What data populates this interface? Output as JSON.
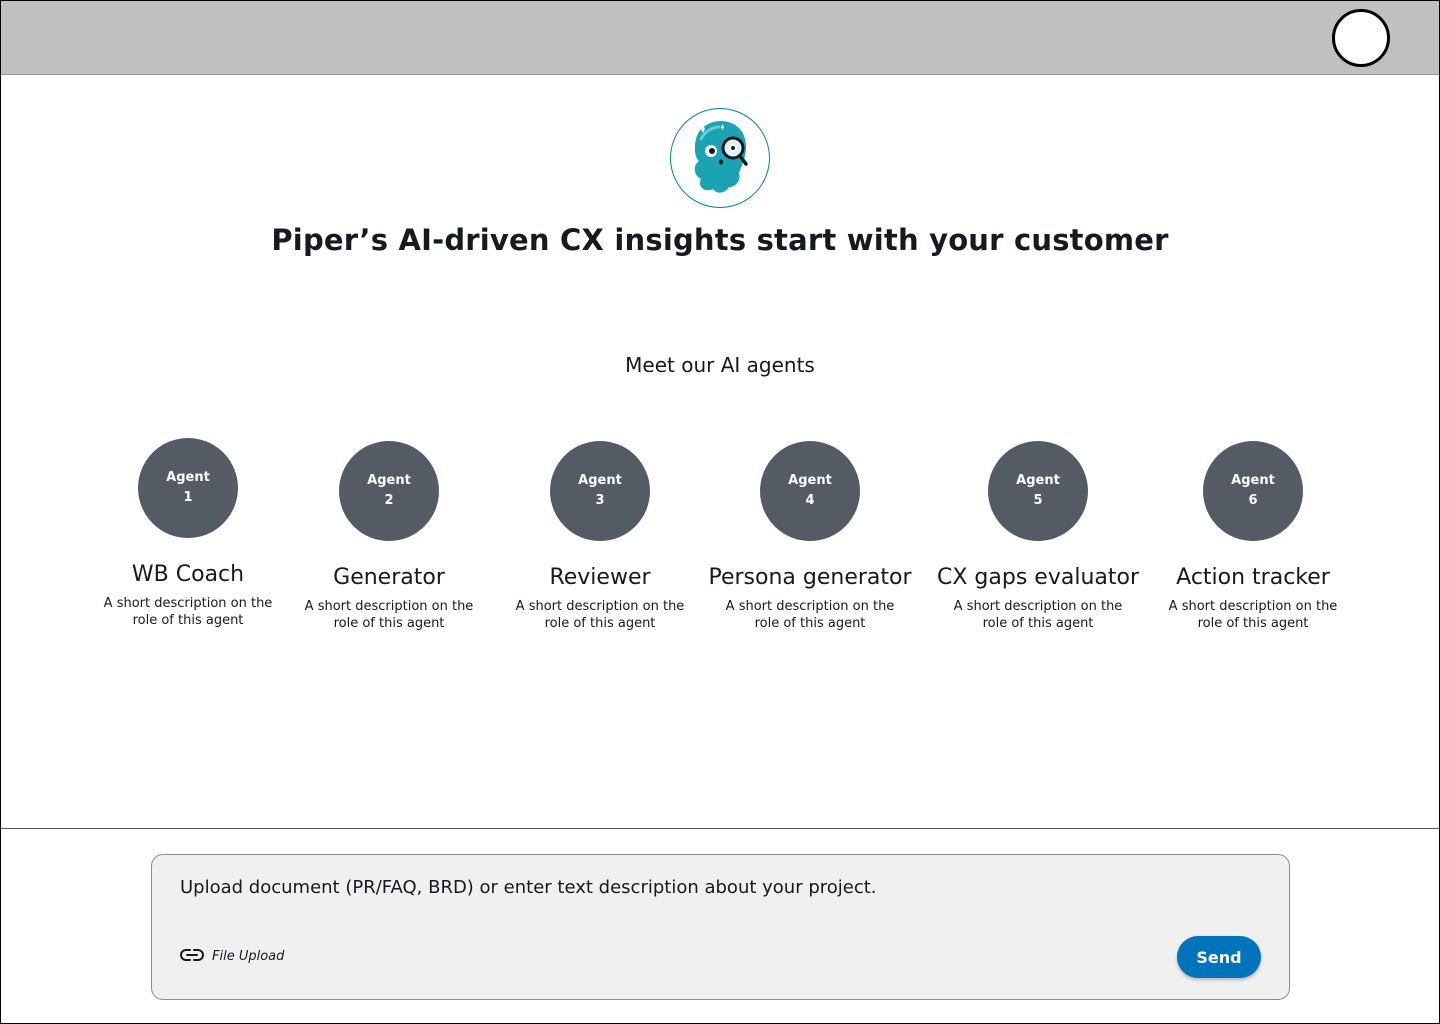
{
  "header": {
    "profile_icon": "profile-circle-icon"
  },
  "hero": {
    "logo_icon": "piper-mascot-logo",
    "headline": "Piper’s AI-driven CX insights start with your customer",
    "subheading": "Meet our AI agents"
  },
  "agents": [
    {
      "badge_label": "Agent",
      "badge_number": "1",
      "name": "WB Coach",
      "description": "A short description on the role of this agent"
    },
    {
      "badge_label": "Agent",
      "badge_number": "2",
      "name": "Generator",
      "description": "A short description on the role of this agent"
    },
    {
      "badge_label": "Agent",
      "badge_number": "3",
      "name": "Reviewer",
      "description": "A short description on the role of this agent"
    },
    {
      "badge_label": "Agent",
      "badge_number": "4",
      "name": "Persona generator",
      "description": "A short description on the role of this agent"
    },
    {
      "badge_label": "Agent",
      "badge_number": "5",
      "name": "CX gaps evaluator",
      "description": "A short description on the role of this agent"
    },
    {
      "badge_label": "Agent",
      "badge_number": "6",
      "name": "Action tracker",
      "description": "A short description on the role of this agent"
    }
  ],
  "composer": {
    "prompt": "Upload document (PR/FAQ, BRD) or enter text description about your project.",
    "file_upload_label": "File Upload",
    "file_upload_icon": "link-icon",
    "send_label": "Send"
  },
  "colors": {
    "topbar": "#c0c0c0",
    "agent_circle": "#545b64",
    "send_button": "#0073bb",
    "logo_teal": "#1ba3b3"
  }
}
